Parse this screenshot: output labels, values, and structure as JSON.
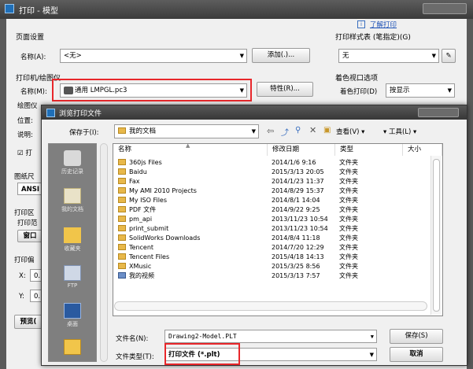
{
  "outer": {
    "title": "打印 - 模型",
    "learn_link": "了解打印",
    "page_setup_group": "页面设置",
    "name_label": "名称(A):",
    "name_value": "<无>",
    "add_button": "添加(.)...",
    "printer_group": "打印机/绘图仪",
    "printer_name_label": "名称(M):",
    "printer_value": "通用 LMPGL.pc3",
    "properties_button": "特性(R)...",
    "plotter_label": "绘图仪",
    "location_label": "位置:",
    "desc_label": "说明:",
    "print_to_file": "打",
    "paper_label": "图纸尺",
    "paper_value": "ANSI",
    "area_label": "打印区",
    "area_range": "打印范",
    "window_button": "窗口",
    "offset_label": "打印偏",
    "x_label": "X:",
    "x_value": "0.",
    "y_label": "Y:",
    "y_value": "0.",
    "preview_button": "预览(",
    "style_table_group": "打印样式表 (笔指定)(G)",
    "style_value": "无",
    "shaded_group": "着色视口选项",
    "shaded_print_label": "着色打印(D)",
    "shaded_print_value": "按显示"
  },
  "dialog": {
    "title": "浏览打印文件",
    "save_in_label": "保存于(I):",
    "save_in_value": "我的文档",
    "view_menu": "查看(V)",
    "tools_menu": "工具(L)",
    "columns": [
      "名称",
      "修改日期",
      "类型",
      "大小"
    ],
    "files": [
      {
        "name": "360js Files",
        "date": "2014/1/6 9:16",
        "type": "文件夹"
      },
      {
        "name": "Baidu",
        "date": "2015/3/13 20:05",
        "type": "文件夹"
      },
      {
        "name": "Fax",
        "date": "2014/1/23 11:37",
        "type": "文件夹"
      },
      {
        "name": "My AMI 2010 Projects",
        "date": "2014/8/29 15:37",
        "type": "文件夹"
      },
      {
        "name": "My ISO Files",
        "date": "2014/8/1 14:04",
        "type": "文件夹"
      },
      {
        "name": "PDF 文件",
        "date": "2014/9/22 9:25",
        "type": "文件夹"
      },
      {
        "name": "pm_api",
        "date": "2013/11/23 10:54",
        "type": "文件夹"
      },
      {
        "name": "print_submit",
        "date": "2013/11/23 10:54",
        "type": "文件夹"
      },
      {
        "name": "SolidWorks Downloads",
        "date": "2014/8/4 11:18",
        "type": "文件夹"
      },
      {
        "name": "Tencent",
        "date": "2014/7/20 12:29",
        "type": "文件夹"
      },
      {
        "name": "Tencent Files",
        "date": "2015/4/18 14:13",
        "type": "文件夹"
      },
      {
        "name": "XMusic",
        "date": "2015/3/25 8:56",
        "type": "文件夹"
      },
      {
        "name": "我的视频",
        "date": "2015/3/13 7:57",
        "type": "文件夹"
      }
    ],
    "places": [
      "历史记录",
      "我的文档",
      "收藏夹",
      "FTP",
      "桌面"
    ],
    "filename_label": "文件名(N):",
    "filename_value": "Drawing2-Model.PLT",
    "filetype_label": "文件类型(T):",
    "filetype_value": "打印文件 (*.plt)",
    "save_button": "保存(S)",
    "cancel_button": "取消"
  },
  "colors": {
    "highlight": "#e8272b",
    "titlebar": "#3b3b3b",
    "folder": "#e8b84a"
  }
}
